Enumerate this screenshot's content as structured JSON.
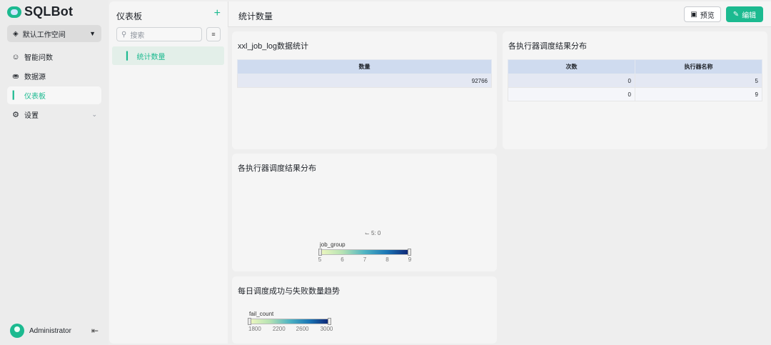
{
  "app": {
    "name": "SQLBot"
  },
  "workspace": {
    "label": "默认工作空间"
  },
  "nav": {
    "items": [
      {
        "label": "智能问数"
      },
      {
        "label": "数据源"
      },
      {
        "label": "仪表板"
      },
      {
        "label": "设置"
      }
    ]
  },
  "user": {
    "name": "Administrator"
  },
  "dashboard_list": {
    "title": "仪表板",
    "search_placeholder": "搜索",
    "items": [
      {
        "label": "统计数量"
      }
    ]
  },
  "header": {
    "title": "统计数量",
    "preview_label": "预览",
    "edit_label": "编辑"
  },
  "cards": [
    {
      "title": "xxl_job_log数据统计",
      "columns": [
        "数量"
      ],
      "rows": [
        [
          "92766"
        ]
      ]
    },
    {
      "title": "各执行器调度结果分布",
      "columns": [
        "次数",
        "执行器名称"
      ],
      "rows": [
        [
          "0",
          "5"
        ],
        [
          "0",
          "9"
        ]
      ]
    },
    {
      "title": "各执行器调度结果分布",
      "tooltip": "5: 0",
      "legend": {
        "title": "job_group",
        "ticks": [
          "5",
          "6",
          "7",
          "8",
          "9"
        ],
        "min": 5,
        "max": 9
      }
    },
    {
      "title": "每日调度成功与失败数量趋势",
      "legend": {
        "title": "fail_count",
        "ticks": [
          "1800",
          "2200",
          "2600",
          "3000"
        ],
        "min": 1700,
        "max": 3050
      }
    }
  ],
  "colors": {
    "accent": "#1cba90",
    "header_bg": "#cfdbef"
  }
}
